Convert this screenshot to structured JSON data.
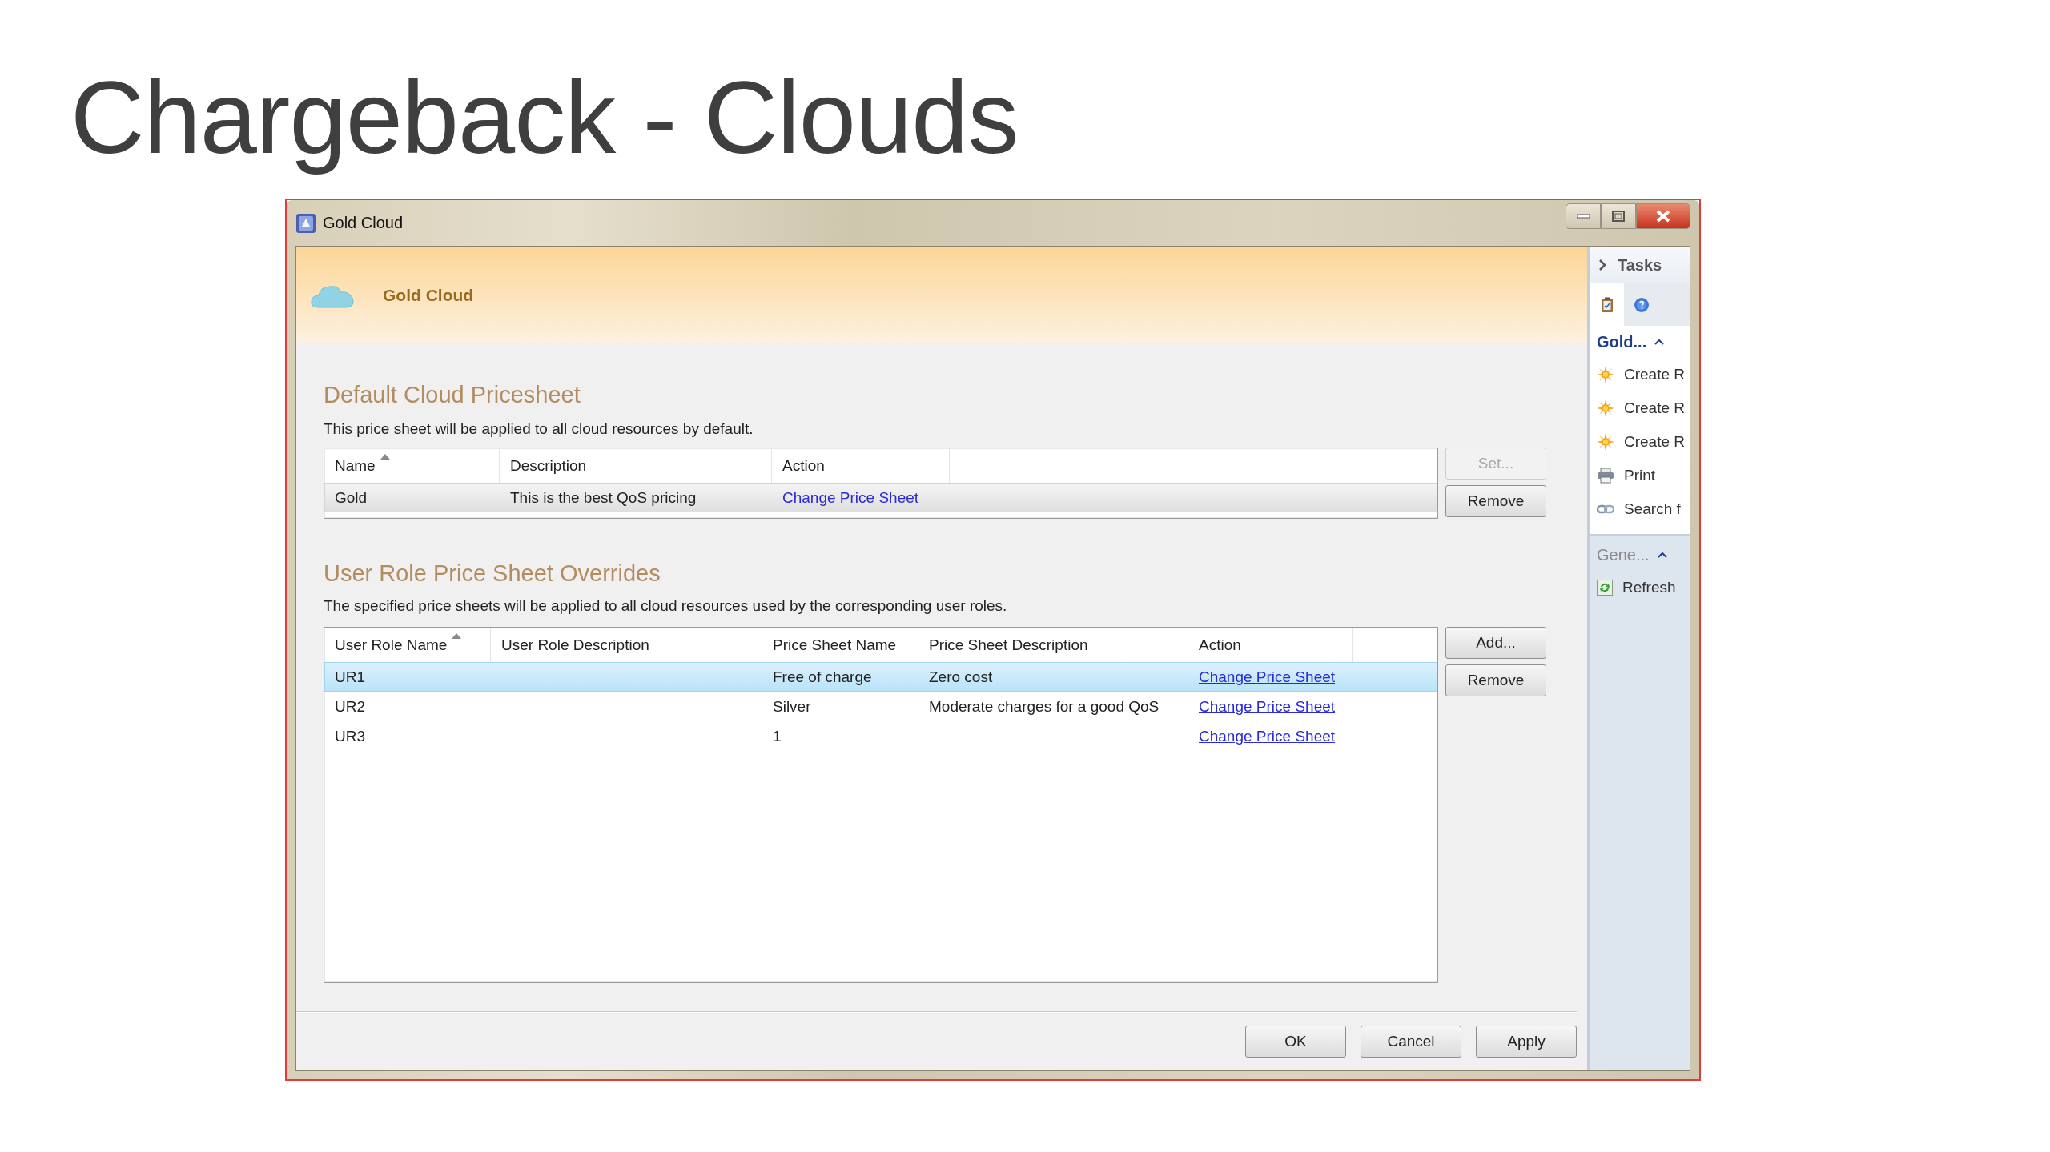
{
  "slide_title": "Chargeback - Clouds",
  "window": {
    "title": "Gold Cloud",
    "header_title": "Gold Cloud"
  },
  "sections": [
    {
      "heading": "Default Cloud Pricesheet",
      "description": "This price sheet will be applied to all cloud resources by default.",
      "focused": false,
      "columns": [
        {
          "label": "Name",
          "sorted": true,
          "kind": "text"
        },
        {
          "label": "Description",
          "sorted": false,
          "kind": "text"
        },
        {
          "label": "Action",
          "sorted": false,
          "kind": "link"
        }
      ],
      "rows": [
        {
          "cells": [
            "Gold",
            "This is the best QoS pricing",
            "Change Price Sheet"
          ],
          "selected": true
        }
      ],
      "buttons": [
        {
          "label": "Set...",
          "disabled": true
        },
        {
          "label": "Remove",
          "disabled": false
        }
      ]
    },
    {
      "heading": "User Role Price Sheet Overrides",
      "description": "The specified price sheets will be applied to all cloud resources used by the corresponding user roles.",
      "focused": true,
      "columns": [
        {
          "label": "User Role Name",
          "sorted": true,
          "kind": "text"
        },
        {
          "label": "User Role Description",
          "sorted": false,
          "kind": "text"
        },
        {
          "label": "Price Sheet Name",
          "sorted": false,
          "kind": "text"
        },
        {
          "label": "Price Sheet Description",
          "sorted": false,
          "kind": "text"
        },
        {
          "label": "Action",
          "sorted": false,
          "kind": "link"
        }
      ],
      "rows": [
        {
          "cells": [
            "UR1",
            null,
            "Free of charge",
            "Zero cost",
            "Change Price Sheet"
          ],
          "selected": true
        },
        {
          "cells": [
            "UR2",
            null,
            "Silver",
            "Moderate charges for a good QoS",
            "Change Price Sheet"
          ],
          "selected": false
        },
        {
          "cells": [
            "UR3",
            null,
            "1",
            null,
            "Change Price Sheet"
          ],
          "selected": false
        }
      ],
      "buttons": [
        {
          "label": "Add...",
          "disabled": false
        },
        {
          "label": "Remove",
          "disabled": false
        }
      ]
    }
  ],
  "dialog_buttons": [
    "OK",
    "Cancel",
    "Apply"
  ],
  "task_pane": {
    "title": "Tasks",
    "groups": [
      {
        "title": "Gold...",
        "active": true,
        "expanded": true,
        "items": [
          {
            "label": "Create R",
            "kind": "sun"
          },
          {
            "label": "Create R",
            "kind": "sun"
          },
          {
            "label": "Create R",
            "kind": "sun"
          },
          {
            "label": "Print",
            "kind": "printer"
          },
          {
            "label": "Search f",
            "kind": "link"
          }
        ]
      },
      {
        "title": "Gene...",
        "active": false,
        "expanded": true,
        "items": [
          {
            "label": "Refresh",
            "kind": "refresh"
          }
        ]
      }
    ]
  }
}
